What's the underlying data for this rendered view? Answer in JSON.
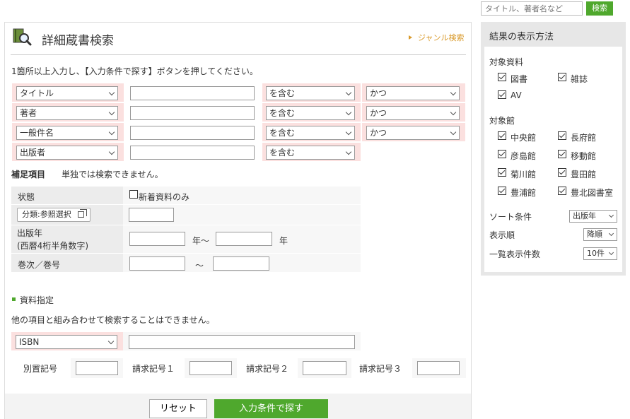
{
  "top_search": {
    "placeholder": "タイトル、著者名など",
    "button": "検索"
  },
  "page": {
    "title": "詳細蔵書検索",
    "genre_link": "ジャンル検索",
    "instruction": "1箇所以上入力し、【入力条件で探す】ボタンを押してください。"
  },
  "conditions": [
    {
      "field": "タイトル",
      "match": "を含む",
      "op": "かつ"
    },
    {
      "field": "著者",
      "match": "を含む",
      "op": "かつ"
    },
    {
      "field": "一般件名",
      "match": "を含む",
      "op": "かつ"
    },
    {
      "field": "出版者",
      "match": "を含む"
    }
  ],
  "supplement": {
    "title": "補足項目",
    "note": "単独では検索できません。",
    "status_label": "状態",
    "new_only": "新着資料のみ",
    "classification_button": "分類:参照選択",
    "pub_year_label_1": "出版年",
    "pub_year_label_2": "(西暦4桁半角数字)",
    "year_from_suffix": "年〜",
    "year_to_suffix": "年",
    "volume_label": "巻次／巻号",
    "volume_sep": "〜"
  },
  "material": {
    "title": "資料指定",
    "note": "他の項目と組み合わせて検索することはできません。",
    "id_type": "ISBN",
    "fields": [
      "別置記号",
      "請求記号１",
      "請求記号２",
      "請求記号３"
    ]
  },
  "buttons": {
    "reset": "リセット",
    "search": "入力条件で探す"
  },
  "side": {
    "title": "結果の表示方法",
    "materials_label": "対象資料",
    "materials": [
      "図書",
      "雑誌",
      "AV"
    ],
    "libraries_label": "対象館",
    "libraries": [
      "中央館",
      "長府館",
      "彦島館",
      "移動館",
      "菊川館",
      "豊田館",
      "豊浦館",
      "豊北図書室"
    ],
    "sort_label": "ソート条件",
    "sort_value": "出版年",
    "order_label": "表示順",
    "order_value": "降順",
    "count_label": "一覧表示件数",
    "count_value": "10件"
  },
  "colors": {
    "accent": "#4fa82d",
    "pink": "#fbe0df",
    "link": "#d99a2b"
  }
}
